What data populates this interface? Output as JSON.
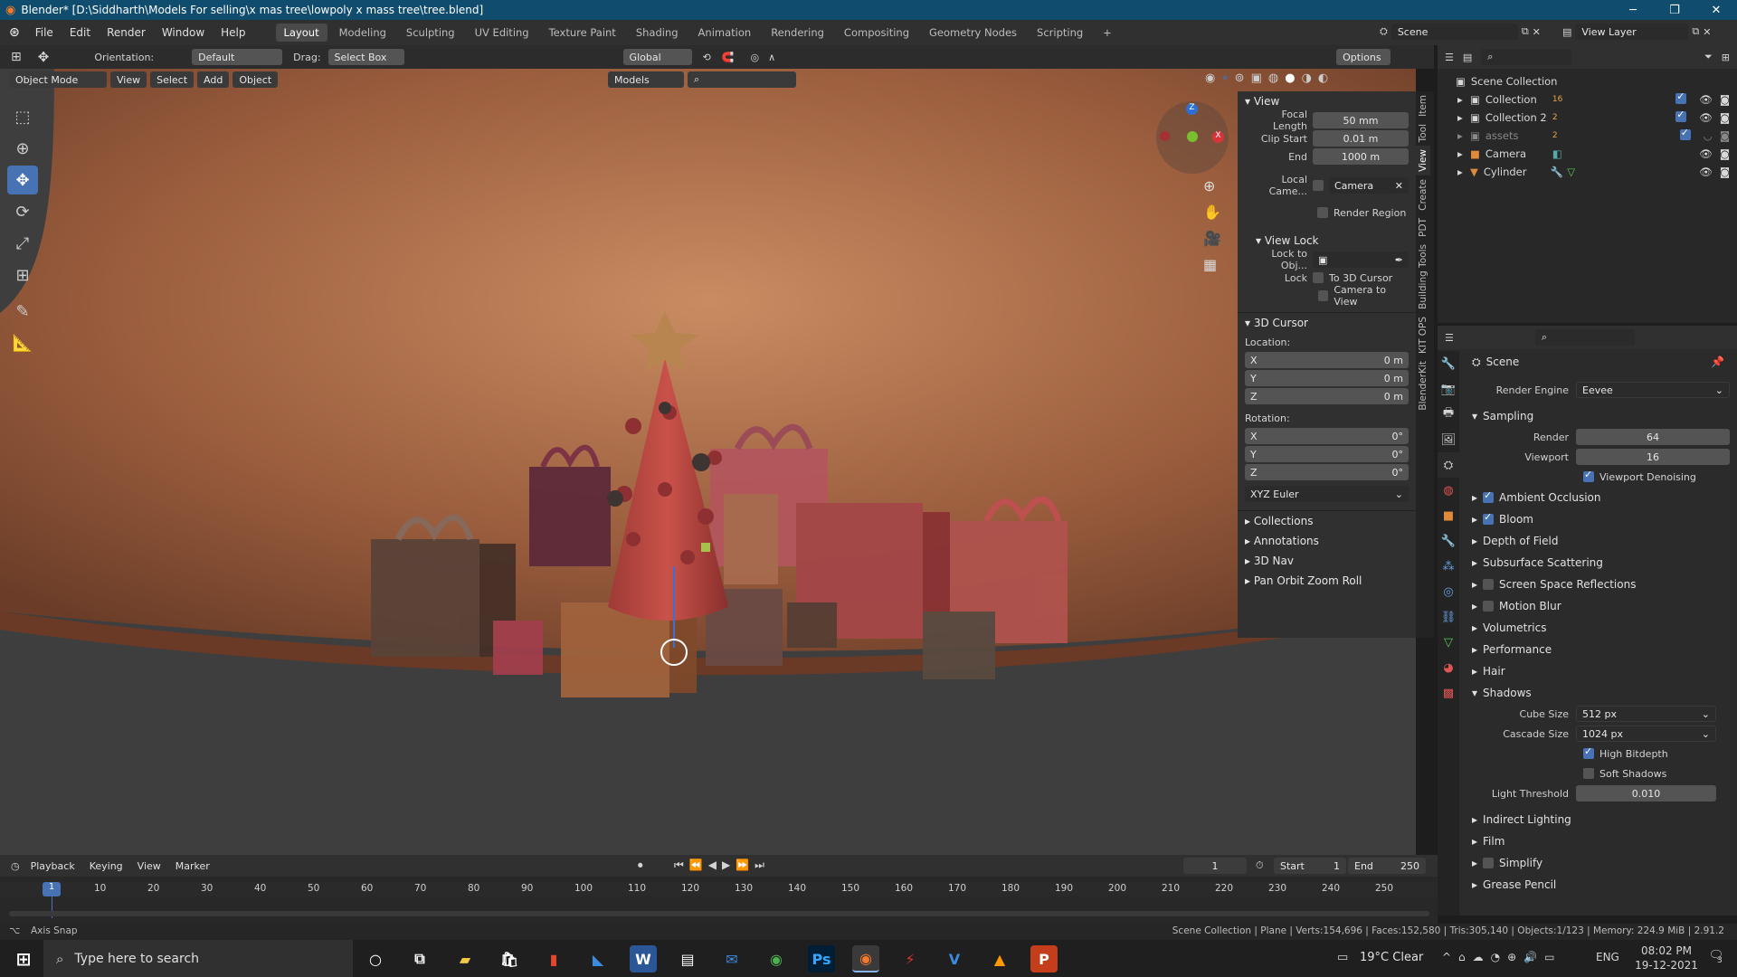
{
  "window": {
    "title": "Blender* [D:\\Siddharth\\Models For selling\\x mas tree\\lowpoly x mass tree\\tree.blend]"
  },
  "menu": [
    "File",
    "Edit",
    "Render",
    "Window",
    "Help"
  ],
  "workspaces": [
    "Layout",
    "Modeling",
    "Sculpting",
    "UV Editing",
    "Texture Paint",
    "Shading",
    "Animation",
    "Rendering",
    "Compositing",
    "Geometry Nodes",
    "Scripting"
  ],
  "top_right": {
    "scene": "Scene",
    "view_layer": "View Layer"
  },
  "header": {
    "orientation_label": "Orientation:",
    "orientation_value": "Default",
    "drag_label": "Drag:",
    "drag_value": "Select Box",
    "transform": "Global",
    "options": "Options",
    "mode": "Object Mode",
    "view": "View",
    "select": "Select",
    "add": "Add",
    "object": "Object",
    "models": "Models"
  },
  "npanel": {
    "view_title": "View",
    "focal_length": {
      "label": "Focal Length",
      "value": "50 mm"
    },
    "clip_start": {
      "label": "Clip Start",
      "value": "0.01 m"
    },
    "clip_end": {
      "label": "End",
      "value": "1000 m"
    },
    "local_camera": {
      "label": "Local Came...",
      "value": "Camera"
    },
    "render_region": "Render Region",
    "view_lock": "View Lock",
    "lock_to_obj": "Lock to Obj...",
    "lock": "Lock",
    "to_3d_cursor": "To 3D Cursor",
    "camera_to_view": "Camera to View",
    "cursor_title": "3D Cursor",
    "location": "Location:",
    "loc": {
      "x": "0 m",
      "y": "0 m",
      "z": "0 m"
    },
    "rotation": "Rotation:",
    "rot": {
      "x": "0°",
      "y": "0°",
      "z": "0°"
    },
    "euler": "XYZ Euler",
    "collapsed": [
      "Collections",
      "Annotations",
      "3D Nav",
      "Pan Orbit Zoom Roll"
    ]
  },
  "vtabs": [
    "Item",
    "Tool",
    "View",
    "Create",
    "PDT",
    "Building Tools",
    "KIT OPS",
    "BlenderKit"
  ],
  "outliner": {
    "root": "Scene Collection",
    "items": [
      {
        "name": "Collection",
        "badge": "16"
      },
      {
        "name": "Collection 2",
        "badge": "2"
      },
      {
        "name": "assets",
        "badge": "2"
      },
      {
        "name": "Camera",
        "badge": ""
      },
      {
        "name": "Cylinder",
        "badge": ""
      }
    ]
  },
  "properties": {
    "context": "Scene",
    "render_engine": {
      "label": "Render Engine",
      "value": "Eevee"
    },
    "sampling": "Sampling",
    "render": {
      "label": "Render",
      "value": "64"
    },
    "viewport": {
      "label": "Viewport",
      "value": "16"
    },
    "viewport_denoising": "Viewport Denoising",
    "sections": [
      {
        "name": "Ambient Occlusion",
        "check": true
      },
      {
        "name": "Bloom",
        "check": true
      },
      {
        "name": "Depth of Field",
        "check": null
      },
      {
        "name": "Subsurface Scattering",
        "check": null
      },
      {
        "name": "Screen Space Reflections",
        "check": false
      },
      {
        "name": "Motion Blur",
        "check": false
      },
      {
        "name": "Volumetrics",
        "check": null
      },
      {
        "name": "Performance",
        "check": null
      },
      {
        "name": "Hair",
        "check": null
      }
    ],
    "shadows": "Shadows",
    "cube_size": {
      "label": "Cube Size",
      "value": "512 px"
    },
    "cascade_size": {
      "label": "Cascade Size",
      "value": "1024 px"
    },
    "high_bitdepth": "High Bitdepth",
    "soft_shadows": "Soft Shadows",
    "light_threshold": {
      "label": "Light Threshold",
      "value": "0.010"
    },
    "after": [
      {
        "name": "Indirect Lighting",
        "check": null
      },
      {
        "name": "Film",
        "check": null
      },
      {
        "name": "Simplify",
        "check": false
      },
      {
        "name": "Grease Pencil",
        "check": null
      }
    ]
  },
  "timeline": {
    "playback": "Playback",
    "keying": "Keying",
    "view": "View",
    "marker": "Marker",
    "current_frame": "1",
    "start_label": "Start",
    "start": "1",
    "end_label": "End",
    "end": "250",
    "ticks": [
      "10",
      "20",
      "30",
      "40",
      "50",
      "60",
      "70",
      "80",
      "90",
      "100",
      "110",
      "120",
      "130",
      "140",
      "150",
      "160",
      "170",
      "180",
      "190",
      "200",
      "210",
      "220",
      "230",
      "240",
      "250"
    ],
    "marker_frame": "1"
  },
  "status": {
    "left": "Axis Snap",
    "right": "Scene Collection | Plane | Verts:154,696 | Faces:152,580 | Tris:305,140 | Objects:1/123 | Memory: 224.9 MiB | 2.91.2"
  },
  "taskbar": {
    "search_placeholder": "Type here to search",
    "weather": "19°C  Clear",
    "lang": "ENG",
    "time": "08:02 PM",
    "date": "19-12-2021",
    "notif": "3"
  }
}
